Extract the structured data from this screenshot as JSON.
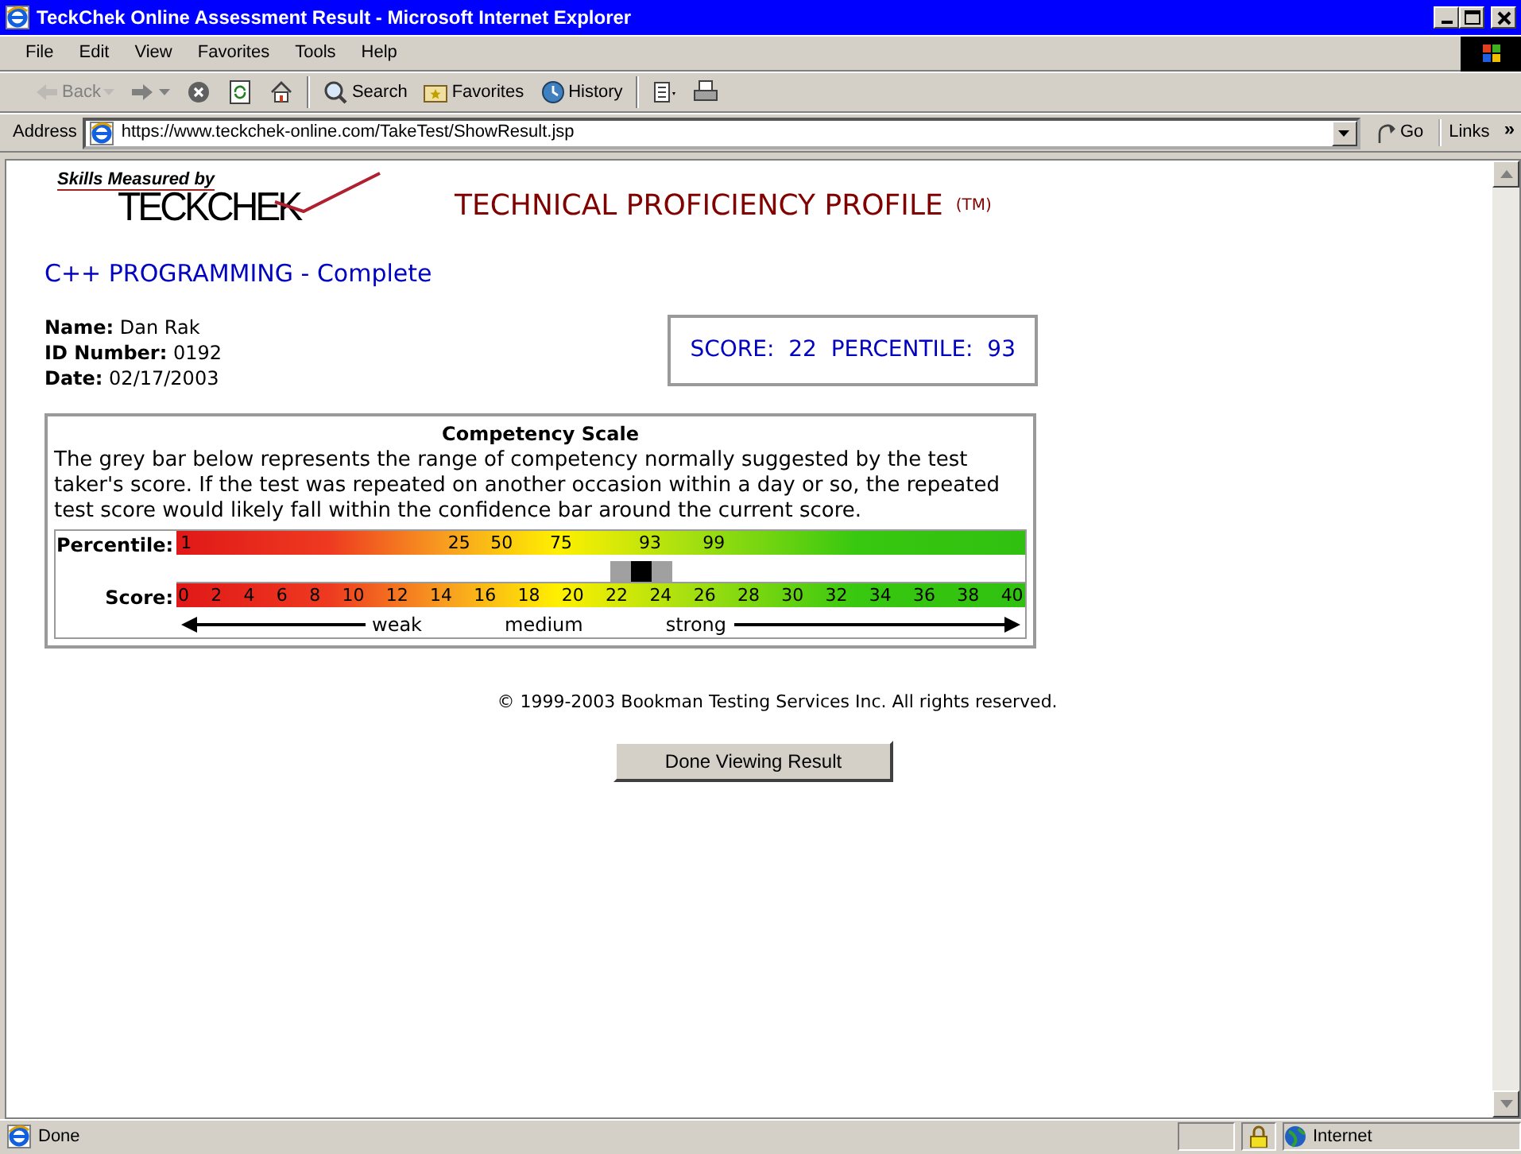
{
  "window": {
    "title": "TeckChek Online Assessment Result - Microsoft Internet Explorer"
  },
  "menu": [
    "File",
    "Edit",
    "View",
    "Favorites",
    "Tools",
    "Help"
  ],
  "toolbar": [
    {
      "kind": "back",
      "label": "Back",
      "disabled": true
    },
    {
      "kind": "forward",
      "disabled": false
    },
    {
      "kind": "stop",
      "disabled": false
    },
    {
      "kind": "refresh",
      "disabled": false
    },
    {
      "kind": "home",
      "disabled": false
    },
    {
      "kind": "search",
      "label": "Search",
      "disabled": false
    },
    {
      "kind": "favorites",
      "label": "Favorites",
      "disabled": false
    },
    {
      "kind": "history",
      "label": "History",
      "disabled": false
    },
    {
      "kind": "mail",
      "disabled": false
    },
    {
      "kind": "print",
      "disabled": false
    }
  ],
  "address": {
    "label": "Address",
    "value": "https://www.teckchek-online.com/TakeTest/ShowResult.jsp",
    "go": "Go",
    "links": "Links",
    "more": "»"
  },
  "page": {
    "logo_caption": "Skills Measured by",
    "logo": "TECKCHEK",
    "heading": "TECHNICAL PROFICIENCY PROFILE",
    "heading_mark": "(TM)",
    "test_title": "C++ PROGRAMMING - Complete",
    "details": [
      {
        "label": "Name:",
        "value": "Dan Rak"
      },
      {
        "label": "ID Number:",
        "value": "0192"
      },
      {
        "label": "Date:",
        "value": "02/17/2003"
      }
    ],
    "score_box": [
      {
        "label": "SCORE:",
        "value": "22"
      },
      {
        "label": "PERCENTILE:",
        "value": "93"
      }
    ],
    "scale": {
      "title": "Competency Scale",
      "text": "The grey bar below represents the range of competency normally suggested by the test taker's score. If the test was repeated on another occasion within a day or so, the repeated test score would likely fall within the confidence bar around the current score.",
      "percentile_label": "Percentile:",
      "percentiles": [
        "1",
        "25",
        "50",
        "75",
        "93",
        "99"
      ],
      "score_label": "Score:",
      "scores": [
        "0",
        "2",
        "4",
        "6",
        "8",
        "10",
        "12",
        "14",
        "16",
        "18",
        "20",
        "22",
        "24",
        "26",
        "28",
        "30",
        "32",
        "34",
        "36",
        "38",
        "40"
      ],
      "level": 0.55,
      "bands": [
        "weak",
        "medium",
        "strong"
      ]
    },
    "copyright": "© 1999-2003 Bookman Testing Services Inc. All rights reserved.",
    "button": "Done Viewing Result"
  },
  "status_bar": {
    "text": "Done",
    "zone": "Internet"
  }
}
